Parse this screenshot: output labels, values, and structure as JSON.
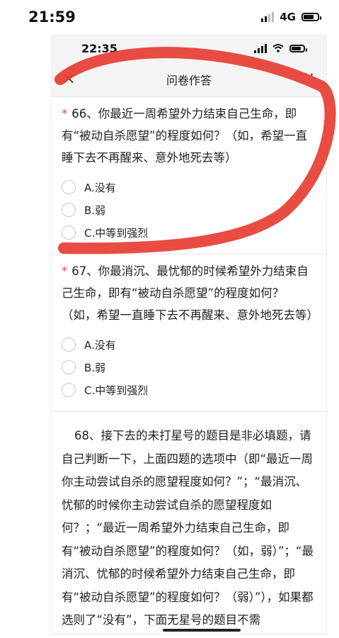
{
  "outer_status": {
    "time": "21:59",
    "network": "4G"
  },
  "inner_status": {
    "time": "22:35"
  },
  "nav": {
    "close": "×",
    "title": "问卷作答",
    "more": "···"
  },
  "q66": {
    "star": "*",
    "text": "66、你最近一周希望外力结束自己生命，即有“被动自杀愿望”的程度如何？（如，希望一直睡下去不再醒来、意外地死去等）",
    "options": [
      "A.没有",
      "B.弱",
      "C.中等到强烈"
    ]
  },
  "q67": {
    "star": "*",
    "text": "67、你最消沉、最忧郁的时候希望外力结束自己生命，即有“被动自杀愿望”的程度如何？（如，希望一直睡下去不再醒来、意外地死去等）",
    "options": [
      "A.没有",
      "B.弱",
      "C.中等到强烈"
    ]
  },
  "q68": {
    "text": "68、接下去的未打星号的题目是非必填题，请自己判断一下，上面四题的选项中（即“最近一周你主动尝试自杀的愿望程度如何？”；“最消沉、忧郁的时候你主动尝试自杀的愿望程度如何？；“最近一周希望外力结束自己生命，即有“被动自杀愿望”的程度如何？（如，弱）”；“最消沉、忧郁的时候希望外力结束自己生命，即有“被动自杀愿望”的程度如何？（弱）”），如果都选则了“没有”，下面无星号的题目不需"
  },
  "colors": {
    "marker": "#e5392d",
    "star": "#e04a4a"
  }
}
